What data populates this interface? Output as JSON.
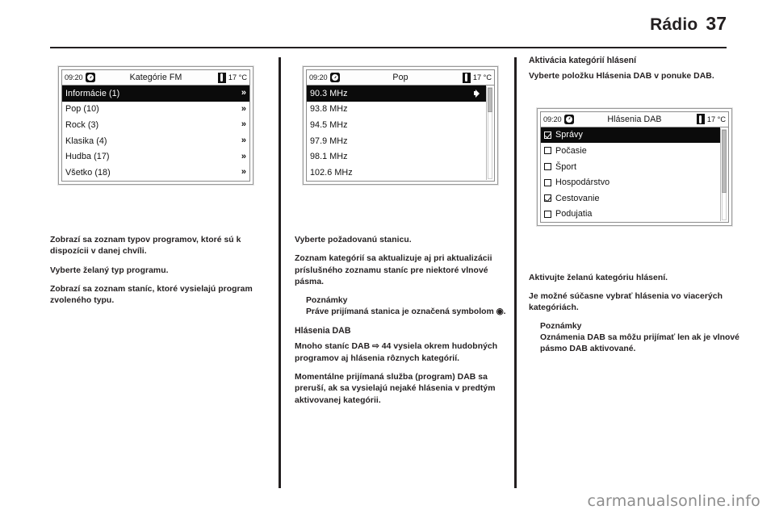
{
  "header": {
    "title": "Rádio",
    "page_number": "37"
  },
  "status_bar": {
    "time": "09:20",
    "temperature": "17 °C",
    "clock_icon": "clock-icon",
    "thermometer_icon": "thermometer-icon"
  },
  "figures": {
    "fm_categories": {
      "title": "Kategórie FM",
      "rows": [
        {
          "label": "Informácie (1)",
          "selected": true,
          "arrow": "»"
        },
        {
          "label": "Pop (10)",
          "selected": false,
          "arrow": "»"
        },
        {
          "label": "Rock (3)",
          "selected": false,
          "arrow": "»"
        },
        {
          "label": "Klasika (4)",
          "selected": false,
          "arrow": "»"
        },
        {
          "label": "Hudba (17)",
          "selected": false,
          "arrow": "»"
        },
        {
          "label": "Všetko (18)",
          "selected": false,
          "arrow": "»"
        }
      ]
    },
    "pop_stations": {
      "title": "Pop",
      "rows": [
        {
          "label": "90.3 MHz",
          "selected": true,
          "icon": "speaker-icon"
        },
        {
          "label": "93.8 MHz",
          "selected": false,
          "icon": ""
        },
        {
          "label": "94.5 MHz",
          "selected": false,
          "icon": ""
        },
        {
          "label": "97.9 MHz",
          "selected": false,
          "icon": ""
        },
        {
          "label": "98.1 MHz",
          "selected": false,
          "icon": ""
        },
        {
          "label": "102.6 MHz",
          "selected": false,
          "icon": ""
        }
      ]
    },
    "dab_announcements": {
      "title": "Hlásenia DAB",
      "rows": [
        {
          "label": "Správy",
          "selected": true,
          "checked": true
        },
        {
          "label": "Počasie",
          "selected": false,
          "checked": false
        },
        {
          "label": "Šport",
          "selected": false,
          "checked": false
        },
        {
          "label": "Hospodárstvo",
          "selected": false,
          "checked": false
        },
        {
          "label": "Cestovanie",
          "selected": false,
          "checked": true
        },
        {
          "label": "Podujatia",
          "selected": false,
          "checked": false
        }
      ]
    }
  },
  "column1": {
    "p1": "Zobrazí sa zoznam typov programov, ktoré sú k dispozícii v danej chvíli.",
    "p2": "Vyberte želaný typ programu.",
    "p3": "Zobrazí sa zoznam staníc, ktoré vysielajú program zvoleného typu."
  },
  "column2": {
    "p1": "Vyberte požadovanú stanicu.",
    "p2": "Zoznam kategórií sa aktualizuje aj pri aktualizácii príslušného zoznamu staníc pre niektoré vlnové pásma.",
    "note_title": "Poznámky",
    "note_body": "Práve prijímaná stanica je označená symbolom ◉.",
    "heading": "Hlásenia DAB",
    "p3": "Mnoho staníc DAB ⇨ 44 vysiela okrem hudobných programov aj hlásenia rôznych kategórií.",
    "p4": "Momentálne prijímaná služba (program) DAB sa preruší, ak sa vysielajú nejaké hlásenia v predtým aktivovanej kategórii."
  },
  "column3": {
    "heading": "Aktivácia kategórií hlásení",
    "p1": "Vyberte položku Hlásenia DAB v ponuke DAB.",
    "p2": "Aktivujte želanú kategóriu hlásení.",
    "p3": "Je možné súčasne vybrať hlásenia vo viacerých kategóriách.",
    "note_title": "Poznámky",
    "note_body": "Oznámenia DAB sa môžu prijímať len ak je vlnové pásmo DAB aktivované."
  },
  "watermark": "carmanualsonline.info"
}
